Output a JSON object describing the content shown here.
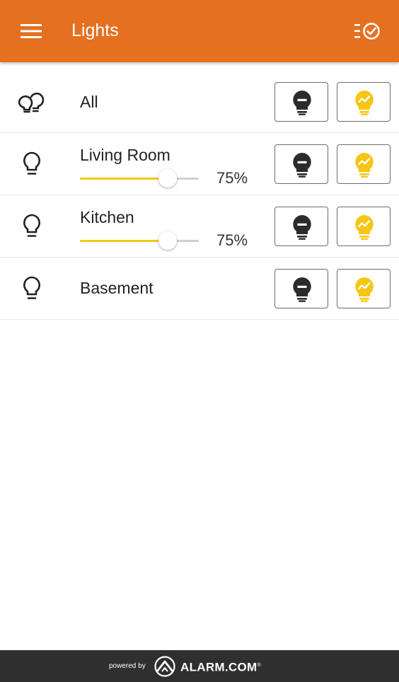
{
  "header": {
    "title": "Lights",
    "menu_icon": "hamburger-menu-icon",
    "schedule_icon": "schedule-check-icon",
    "accent_color": "#e47020"
  },
  "rows": [
    {
      "label": "All",
      "icon": "multi-bulb-icon",
      "has_slider": false
    },
    {
      "label": "Living Room",
      "icon": "bulb-outline-icon",
      "has_slider": true,
      "level": 75,
      "level_text": "75%"
    },
    {
      "label": "Kitchen",
      "icon": "bulb-outline-icon",
      "has_slider": true,
      "level": 75,
      "level_text": "75%"
    },
    {
      "label": "Basement",
      "icon": "bulb-outline-icon",
      "has_slider": false
    }
  ],
  "buttons": {
    "off_icon": "bulb-off-icon",
    "on_icon": "bulb-on-icon",
    "on_color": "#f7c614",
    "off_color": "#2b2b2b"
  },
  "footer": {
    "powered_by": "powered by",
    "brand": "ALARM.COM",
    "brand_mark": "®"
  }
}
